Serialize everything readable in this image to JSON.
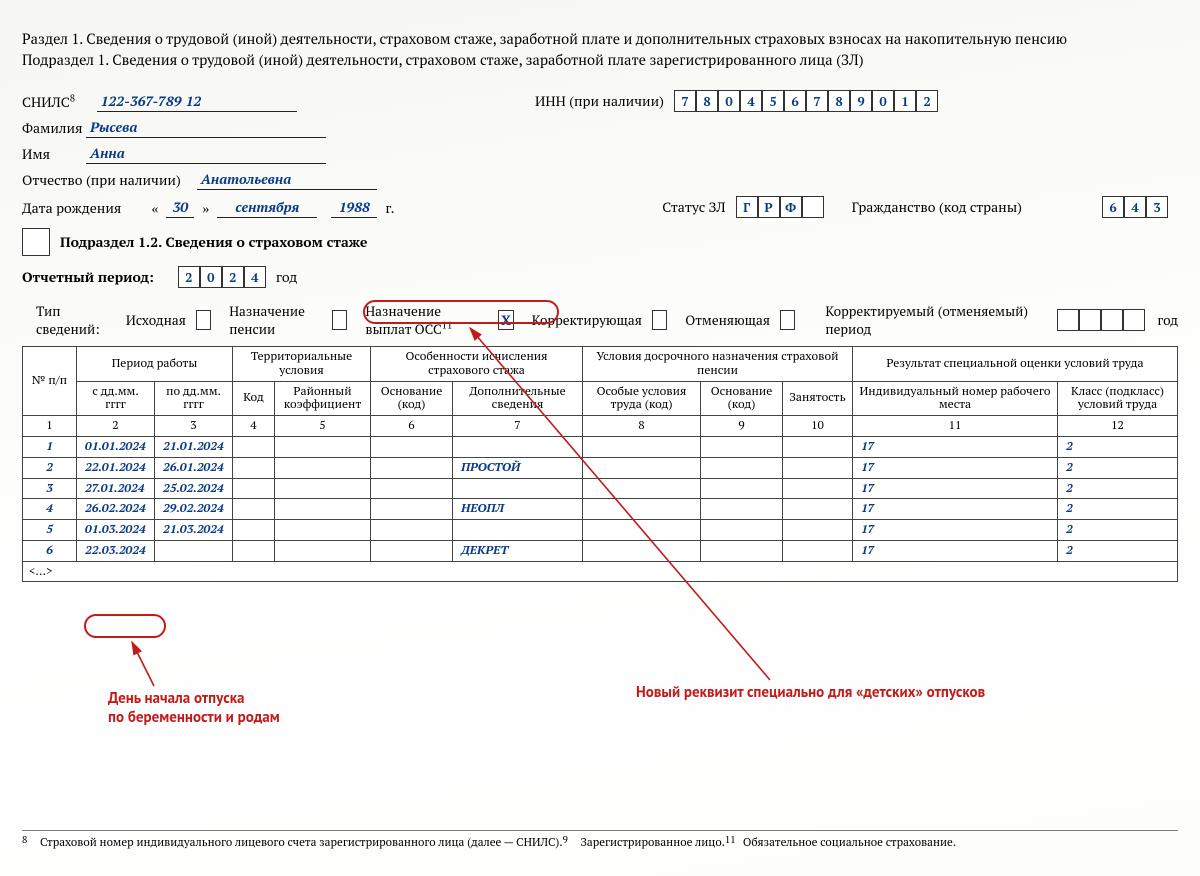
{
  "titles": {
    "section": "Раздел 1. Сведения о трудовой (иной) деятельности, страховом стаже, заработной плате и дополнительных страховых взносах на накопительную пенсию",
    "subsection": "Подраздел 1. Сведения о трудовой (иной) деятельности, страховом стаже, заработной плате зарегистрированного лица (ЗЛ)"
  },
  "ident": {
    "snils_label": "СНИЛС",
    "snils_fn": "8",
    "snils_value": "122-367-789 12",
    "inn_label": "ИНН (при наличии)",
    "inn_digits": [
      "7",
      "8",
      "0",
      "4",
      "5",
      "6",
      "7",
      "8",
      "9",
      "0",
      "1",
      "2"
    ],
    "surname_label": "Фамилия",
    "surname_value": "Рысева",
    "name_label": "Имя",
    "name_value": "Анна",
    "patr_label": "Отчество (при наличии)",
    "patr_value": "Анатольевна",
    "dob_label": "Дата рождения",
    "dob_day": "30",
    "dob_month": "сентября",
    "dob_year": "1988",
    "dob_year_suffix": "г.",
    "status_label": "Статус ЗЛ",
    "status_digits": [
      "Г",
      "Р",
      "Ф",
      ""
    ],
    "citizenship_label": "Гражданство (код страны)",
    "citizenship_digits": [
      "6",
      "4",
      "3"
    ]
  },
  "sub12": {
    "label": "Подраздел 1.2. Сведения о страховом стаже",
    "period_label": "Отчетный период:",
    "period_digits": [
      "2",
      "0",
      "2",
      "4"
    ],
    "period_suffix": "год"
  },
  "types": {
    "label": "Тип сведений:",
    "items": [
      {
        "text": "Исходная"
      },
      {
        "text": "Назначение пенсии"
      },
      {
        "text": "Назначение выплат ОСС",
        "fn": "11",
        "checked": "Х"
      },
      {
        "text": "Корректирующая"
      },
      {
        "text": "Отменяющая"
      }
    ],
    "corr_period_label": "Корректируемый (отменяемый) период",
    "corr_suffix": "год"
  },
  "table": {
    "headers": {
      "num": "№ п/п",
      "period": "Период работы",
      "from": "с дд.мм. гггг",
      "to": "по дд.мм. гггг",
      "terr": "Территориальные условия",
      "terr_code": "Код",
      "terr_coef": "Районный коэффициент",
      "stazh": "Особенности исчисления страхового стажа",
      "stazh_base": "Основание (код)",
      "stazh_add": "Дополнительные сведения",
      "early": "Условия досрочного назначения страховой пенсии",
      "early_special": "Особые условия труда (код)",
      "early_base": "Основание (код)",
      "early_emp": "Занятость",
      "sout": "Результат специальной оценки условий труда",
      "sout_num": "Индивидуальный номер рабочего места",
      "sout_class": "Класс (подкласс) условий труда"
    },
    "colnums": [
      "1",
      "2",
      "3",
      "4",
      "5",
      "6",
      "7",
      "8",
      "9",
      "10",
      "11",
      "12"
    ],
    "rows": [
      {
        "n": "1",
        "from": "01.01.2024",
        "to": "21.01.2024",
        "add": "",
        "wp": "17",
        "cl": "2"
      },
      {
        "n": "2",
        "from": "22.01.2024",
        "to": "26.01.2024",
        "add": "ПРОСТОЙ",
        "wp": "17",
        "cl": "2"
      },
      {
        "n": "3",
        "from": "27.01.2024",
        "to": "25.02.2024",
        "add": "",
        "wp": "17",
        "cl": "2"
      },
      {
        "n": "4",
        "from": "26.02.2024",
        "to": "29.02.2024",
        "add": "НЕОПЛ",
        "wp": "17",
        "cl": "2"
      },
      {
        "n": "5",
        "from": "01.03.2024",
        "to": "21.03.2024",
        "add": "",
        "wp": "17",
        "cl": "2"
      },
      {
        "n": "6",
        "from": "22.03.2024",
        "to": "",
        "add": "ДЕКРЕТ",
        "wp": "17",
        "cl": "2"
      }
    ],
    "ellipsis": "<…>"
  },
  "annotations": {
    "left": "День начала отпуска\nпо беременности и родам",
    "right": "Новый реквизит специально для «детских» отпусков"
  },
  "footnotes": [
    {
      "n": "8",
      "text": "Страховой номер индивидуального лицевого счета зарегистрированного лица (далее — СНИЛС)."
    },
    {
      "n": "9",
      "text": "Зарегистрированное лицо."
    },
    {
      "n": "11",
      "text": "Обязательное социальное страхование."
    }
  ],
  "misc": {
    "quote_open": "«",
    "quote_close": "»"
  }
}
